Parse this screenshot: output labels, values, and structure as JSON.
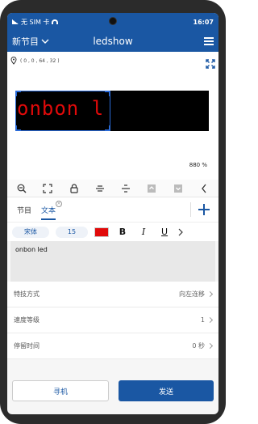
{
  "status_bar": {
    "sim": "无 SIM 卡",
    "time": "16:07"
  },
  "header": {
    "project": "新节目",
    "title": "ledshow"
  },
  "preview": {
    "coords": "( 0 , 0 , 64 , 32 )",
    "led_text": "onbon l",
    "zoom": "880 %"
  },
  "toolbar": {
    "icons": [
      "zoom-out-icon",
      "fit-screen-icon",
      "lock-icon",
      "align-center-h-icon",
      "align-center-v-icon",
      "move-up-icon",
      "move-down-icon",
      "back-icon"
    ]
  },
  "tabs": {
    "items": [
      "节目",
      "文本"
    ],
    "active": "文本",
    "close_mark": "×",
    "add_symbol": "+"
  },
  "format": {
    "font": "宋体",
    "size": "15",
    "text_color": "#e10a0a",
    "bold": "B",
    "italic": "I",
    "underline": "U"
  },
  "text_content": "onbon led",
  "settings": [
    {
      "label": "特技方式",
      "value": "向左连移"
    },
    {
      "label": "速度等级",
      "value": "1"
    },
    {
      "label": "停留时间",
      "value": "0 秒"
    }
  ],
  "buttons": {
    "search": "寻机",
    "send": "发送"
  }
}
